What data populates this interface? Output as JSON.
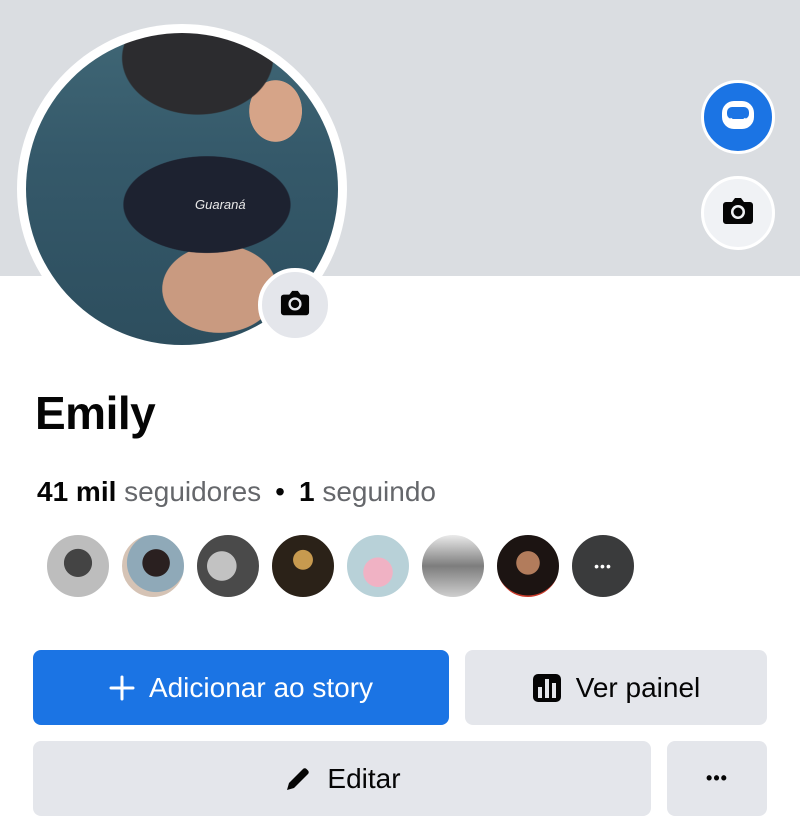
{
  "profile": {
    "name": "Emily",
    "photo_shirt_text": "Guaraná",
    "followers_count": "41 mil",
    "followers_label": "seguidores",
    "separator": "•",
    "following_count": "1",
    "following_label": "seguindo"
  },
  "icons": {
    "cover_avatar": "avatar-icon",
    "cover_camera": "camera-icon",
    "profile_camera": "camera-icon",
    "add_story": "plus-icon",
    "dashboard": "bar-chart-icon",
    "edit": "pencil-icon",
    "more": "more-dots-icon"
  },
  "friends": {
    "avatars": [
      "friend-1",
      "friend-2",
      "friend-3",
      "friend-4",
      "friend-5",
      "friend-6",
      "friend-7"
    ],
    "more_label": "•••"
  },
  "actions": {
    "add_story_label": "Adicionar ao story",
    "dashboard_label": "Ver painel",
    "edit_label": "Editar",
    "more_label": "•••"
  },
  "colors": {
    "primary": "#1b74e4",
    "secondary_button": "#e4e6eb",
    "cover": "#dadde1",
    "muted_text": "#65676b"
  }
}
